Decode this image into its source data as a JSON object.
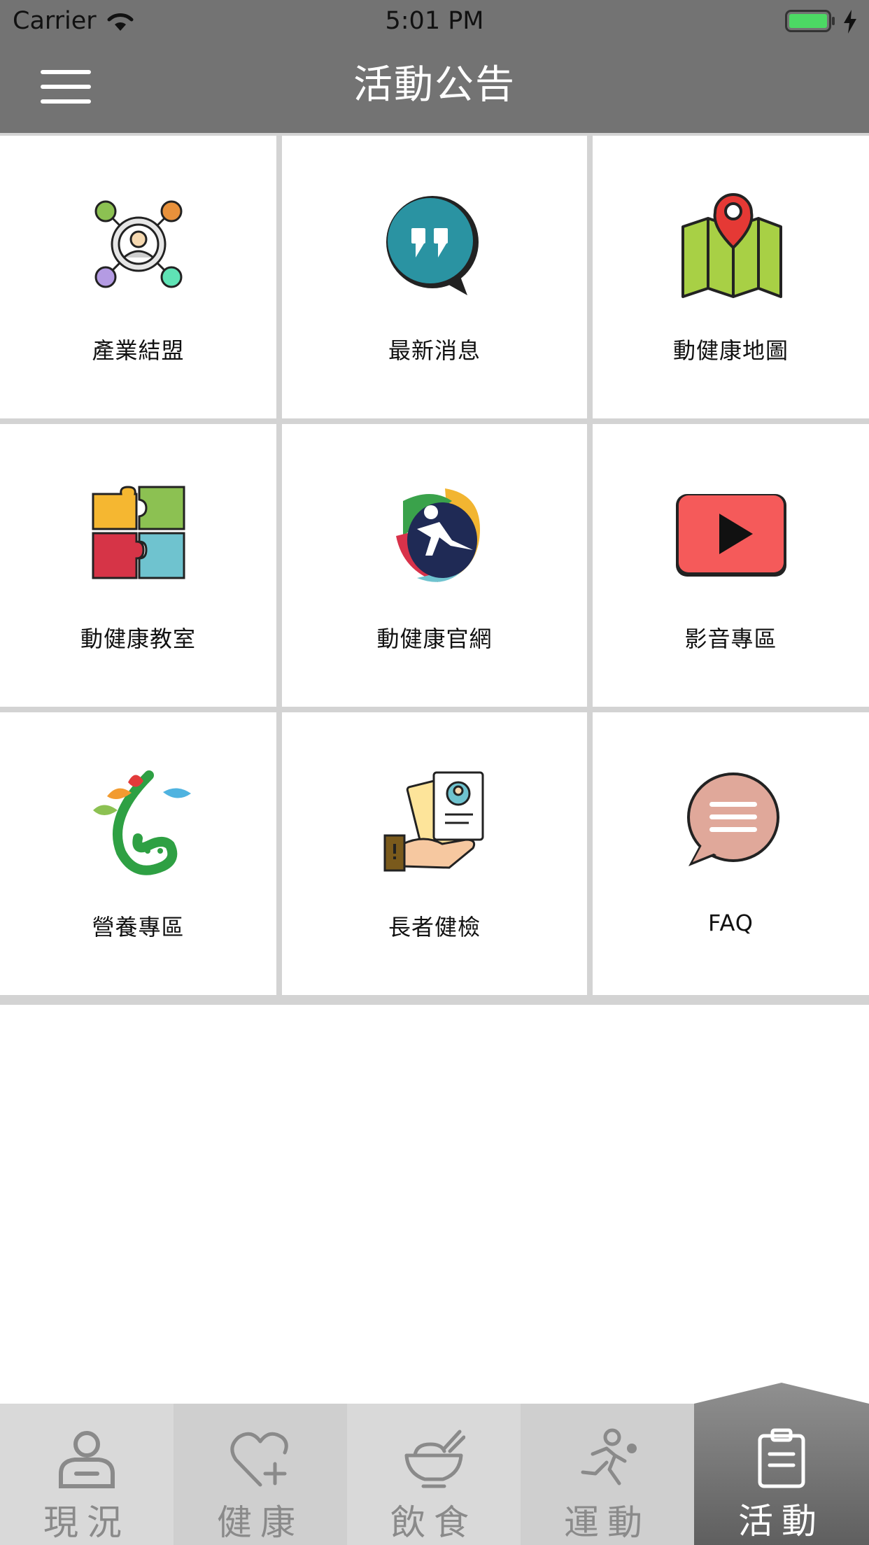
{
  "status_bar": {
    "carrier": "Carrier",
    "time": "5:01 PM"
  },
  "header": {
    "title": "活動公告",
    "menu_icon": "hamburger-menu-icon"
  },
  "grid": {
    "items": [
      {
        "label": "產業結盟",
        "icon": "network-people-icon"
      },
      {
        "label": "最新消息",
        "icon": "quote-bubble-icon"
      },
      {
        "label": "動健康地圖",
        "icon": "map-pin-icon"
      },
      {
        "label": "動健康教室",
        "icon": "puzzle-icon"
      },
      {
        "label": "動健康官網",
        "icon": "runner-logo-icon"
      },
      {
        "label": "影音專區",
        "icon": "play-video-icon"
      },
      {
        "label": "營養專區",
        "icon": "nutrition-logo-icon"
      },
      {
        "label": "長者健檢",
        "icon": "health-card-hand-icon"
      },
      {
        "label": "FAQ",
        "icon": "faq-chat-icon"
      }
    ]
  },
  "tabs": [
    {
      "label": "現況",
      "icon": "person-status-icon",
      "active": false
    },
    {
      "label": "健康",
      "icon": "heart-plus-icon",
      "active": false
    },
    {
      "label": "飲食",
      "icon": "food-bowl-icon",
      "active": false
    },
    {
      "label": "運動",
      "icon": "running-person-icon",
      "active": false
    },
    {
      "label": "活動",
      "icon": "clipboard-icon",
      "active": true
    }
  ],
  "colors": {
    "header_bg": "#737373",
    "grid_divider": "#d3d3d3",
    "tab_active_bg": "#6f6f6f",
    "tab_inactive_bg": "#d8d8d8",
    "battery_green": "#4cd964"
  }
}
